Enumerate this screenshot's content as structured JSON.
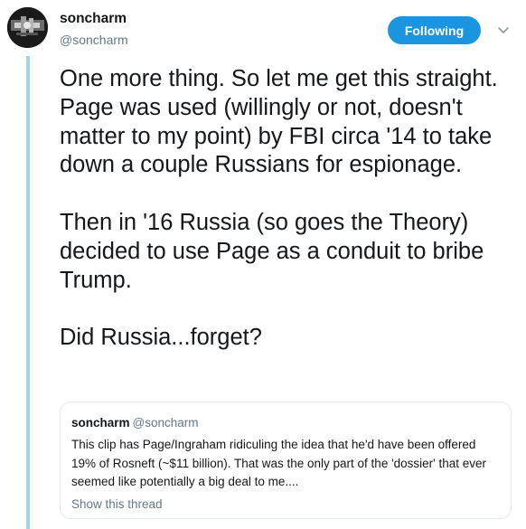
{
  "tweet": {
    "author_name": "soncharm",
    "author_handle": "@soncharm",
    "follow_label": "Following",
    "paragraphs": [
      "One more thing. So let me get this straight. Page was used (willingly or not, doesn't matter to my point) by FBI circa '14 to take down a couple Russians for espionage.",
      "Then in '16 Russia (so goes the Theory) decided to use Page as a conduit to bribe Trump.",
      "Did Russia...forget?"
    ]
  },
  "quoted": {
    "author_name": "soncharm",
    "author_handle": "@soncharm",
    "text": "This clip has Page/Ingraham ridiculing the idea that he'd have been offered 19% of Rosneft (~$11 billion). That was the only part of the 'dossier' that ever seemed like potentially a big deal to me....",
    "show_thread_label": "Show this thread"
  },
  "colors": {
    "accent": "#1b95e0",
    "thread_line": "#9ed4e8",
    "secondary_text": "#657786"
  }
}
